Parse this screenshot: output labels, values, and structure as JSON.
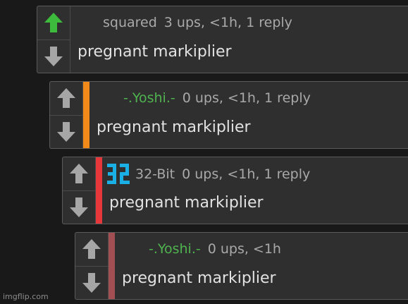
{
  "thread": {
    "comments": [
      {
        "username": "squared",
        "stats": "3 ups, <1h, 1 reply",
        "text": "pregnant markiplier",
        "username_color": "#a9a9a9",
        "stripe_color": "",
        "upvoted": true
      },
      {
        "username": "-.Yoshi.-",
        "stats": "0 ups, <1h, 1 reply",
        "text": "pregnant markiplier",
        "username_color": "#4fb34f",
        "stripe_color": "#f28a1a",
        "upvoted": false
      },
      {
        "username": "32-Bit",
        "stats": "0 ups, <1h, 1 reply",
        "text": "pregnant markiplier",
        "username_color": "#a9a9a9",
        "stripe_color": "#e8373a",
        "upvoted": false,
        "badge_icon": "32-bit-badge-icon",
        "badge_color": "#1ab0e6"
      },
      {
        "username": "-.Yoshi.-",
        "stats": "0 ups, <1h",
        "text": "pregnant markiplier",
        "username_color": "#4fb34f",
        "stripe_color": "#a14f52",
        "upvoted": false
      }
    ]
  },
  "icons": {
    "upvote": "up-arrow-icon",
    "downvote": "down-arrow-icon"
  },
  "colors": {
    "upvote_active": "#3dbb3d",
    "vote_inactive": "#a6a6a6"
  },
  "watermark": "imgflip.com"
}
